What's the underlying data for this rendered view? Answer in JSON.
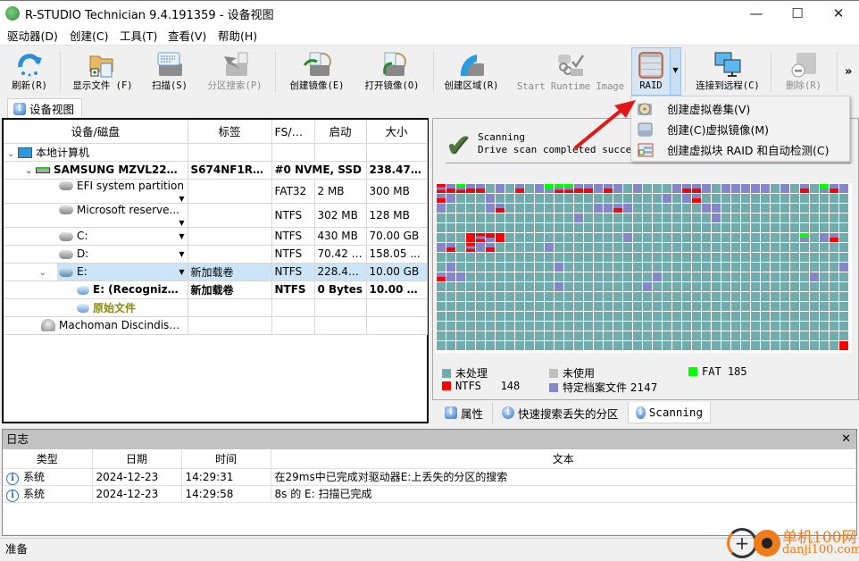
{
  "window": {
    "title": "R-STUDIO Technician 9.4.191359 - 设备视图",
    "minimize": "—",
    "maximize": "☐",
    "close": "✕"
  },
  "menu": [
    "驱动器(D)",
    "创建(C)",
    "工具(T)",
    "查看(V)",
    "帮助(H)"
  ],
  "toolbar": {
    "refresh": "刷新(R)",
    "show_files": "显示文件 (F)",
    "scan": "扫描(S)",
    "partition_search": "分区搜索(P)",
    "create_image": "创建镜像(E)",
    "open_image": "打开镜像(O)",
    "create_region": "创建区域(R)",
    "start_runtime_image": "Start Runtime Image",
    "raid": "RAID",
    "connect_remote": "连接到远程(C)",
    "delete": "删除(R)",
    "more": "»"
  },
  "raid_menu": [
    "创建虚拟卷集(V)",
    "创建(C)虚拟镜像(M)",
    "创建虚拟块 RAID 和自动检测(C)"
  ],
  "device_tab": "设备视图",
  "device_table": {
    "columns": [
      "设备/磁盘",
      "标签",
      "FS/界面",
      "启动",
      "大小"
    ],
    "rows": [
      {
        "name": "本地计算机",
        "label": "",
        "fs": "",
        "start": "",
        "size": ""
      },
      {
        "name": "SAMSUNG MZVL225...",
        "label": "S674NF1R83...",
        "fs": "#0 NVME, SSD",
        "start": "",
        "size": "238.47 ..."
      },
      {
        "name": "EFI system partition",
        "label": "",
        "fs": "FAT32",
        "start": "2 MB",
        "size": "300 MB"
      },
      {
        "name": "Microsoft reserve...",
        "label": "",
        "fs": "NTFS",
        "start": "302 MB",
        "size": "128 MB"
      },
      {
        "name": "C:",
        "label": "",
        "fs": "NTFS",
        "start": "430 MB",
        "size": "70.00 GB"
      },
      {
        "name": "D:",
        "label": "",
        "fs": "NTFS",
        "start": "70.42 GB",
        "size": "158.05 ..."
      },
      {
        "name": "E:",
        "label": "新加载卷",
        "fs": "NTFS",
        "start": "228.48 ...",
        "size": "10.00 GB"
      },
      {
        "name": "E: (Recognize...",
        "label": "新加载卷",
        "fs": "NTFS",
        "start": "0 Bytes",
        "size": "10.00 GB"
      },
      {
        "name": "原始文件",
        "label": "",
        "fs": "",
        "start": "",
        "size": ""
      },
      {
        "name": "Machoman Discindisk...",
        "label": "",
        "fs": "",
        "start": "",
        "size": ""
      }
    ]
  },
  "scan_status": {
    "title": "Scanning",
    "message": "Drive scan completed successfully"
  },
  "legend": {
    "unprocessed": "未处理",
    "unused": "未使用",
    "fat": "FAT 185",
    "ntfs": "NTFS   148",
    "specific_files": "特定档案文件 2147"
  },
  "colors": {
    "unprocessed": "#72abab",
    "unused": "#c0c0c0",
    "fat": "#00ff00",
    "ntfs": "#ff0000",
    "specific": "#8585c9",
    "selection": "#cce4f7",
    "raw_text": "#8c8c00"
  },
  "scan_map": {
    "columns": 42,
    "rows": 17,
    "marks": [
      [
        0,
        0,
        "rpr"
      ],
      [
        0,
        1,
        "pr"
      ],
      [
        0,
        2,
        "gpr"
      ],
      [
        0,
        3,
        "pr"
      ],
      [
        0,
        4,
        "pr"
      ],
      [
        0,
        6,
        "p"
      ],
      [
        0,
        8,
        "pr"
      ],
      [
        0,
        10,
        "p"
      ],
      [
        0,
        11,
        "gp"
      ],
      [
        0,
        12,
        "gpr"
      ],
      [
        0,
        13,
        "gpr"
      ],
      [
        0,
        14,
        "pr"
      ],
      [
        0,
        15,
        "pr"
      ],
      [
        0,
        16,
        "p"
      ],
      [
        0,
        17,
        "pr"
      ],
      [
        0,
        18,
        "p"
      ],
      [
        0,
        20,
        "p"
      ],
      [
        0,
        24,
        "p"
      ],
      [
        0,
        25,
        "pr"
      ],
      [
        0,
        26,
        "pr"
      ],
      [
        0,
        27,
        "p"
      ],
      [
        0,
        29,
        "p"
      ],
      [
        0,
        30,
        "p"
      ],
      [
        0,
        31,
        "p"
      ],
      [
        0,
        32,
        "p"
      ],
      [
        0,
        33,
        "p"
      ],
      [
        0,
        35,
        "p"
      ],
      [
        0,
        37,
        "pr"
      ],
      [
        0,
        39,
        "gp"
      ],
      [
        0,
        40,
        "pr"
      ],
      [
        0,
        41,
        "p"
      ],
      [
        1,
        0,
        "pr"
      ],
      [
        1,
        1,
        "p"
      ],
      [
        1,
        5,
        "p"
      ],
      [
        1,
        23,
        "p"
      ],
      [
        1,
        25,
        "p"
      ],
      [
        1,
        26,
        "pr"
      ],
      [
        2,
        0,
        "p"
      ],
      [
        2,
        5,
        "p"
      ],
      [
        2,
        6,
        "pr"
      ],
      [
        2,
        16,
        "p"
      ],
      [
        2,
        17,
        "p"
      ],
      [
        2,
        18,
        "pr"
      ],
      [
        2,
        19,
        "p"
      ],
      [
        2,
        27,
        "p"
      ],
      [
        2,
        28,
        "p"
      ],
      [
        3,
        14,
        "p"
      ],
      [
        3,
        28,
        "p"
      ],
      [
        5,
        3,
        "r"
      ],
      [
        5,
        4,
        "rpr"
      ],
      [
        5,
        5,
        "rp"
      ],
      [
        5,
        6,
        "r"
      ],
      [
        5,
        19,
        "p"
      ],
      [
        5,
        37,
        "gp"
      ],
      [
        5,
        39,
        "p"
      ],
      [
        5,
        40,
        "pr"
      ],
      [
        6,
        0,
        "p"
      ],
      [
        6,
        1,
        "pr"
      ],
      [
        6,
        3,
        "rpr"
      ],
      [
        6,
        4,
        "p"
      ],
      [
        6,
        5,
        "pr"
      ],
      [
        6,
        11,
        "p"
      ],
      [
        8,
        1,
        "p"
      ],
      [
        8,
        12,
        "p"
      ],
      [
        8,
        41,
        "p"
      ],
      [
        9,
        0,
        "pr"
      ],
      [
        9,
        1,
        "p"
      ],
      [
        9,
        2,
        "p"
      ],
      [
        9,
        22,
        "p"
      ],
      [
        9,
        38,
        "p"
      ],
      [
        10,
        12,
        "p"
      ],
      [
        10,
        21,
        "p"
      ],
      [
        16,
        41,
        "r"
      ]
    ]
  },
  "bottom_tabs": [
    "属性",
    "快速搜索丢失的分区",
    "Scanning"
  ],
  "log": {
    "title": "日志",
    "columns": [
      "类型",
      "日期",
      "时间",
      "文本"
    ],
    "rows": [
      {
        "type": "系统",
        "date": "2024-12-23",
        "time": "14:29:31",
        "text": "在29ms中已完成对驱动器E:上丢失的分区的搜索"
      },
      {
        "type": "系统",
        "date": "2024-12-23",
        "time": "14:29:58",
        "text": "8s 的 E: 扫描已完成"
      }
    ]
  },
  "status": "准备",
  "watermark": {
    "cn": "单机100网",
    "en": "danji100.com"
  }
}
